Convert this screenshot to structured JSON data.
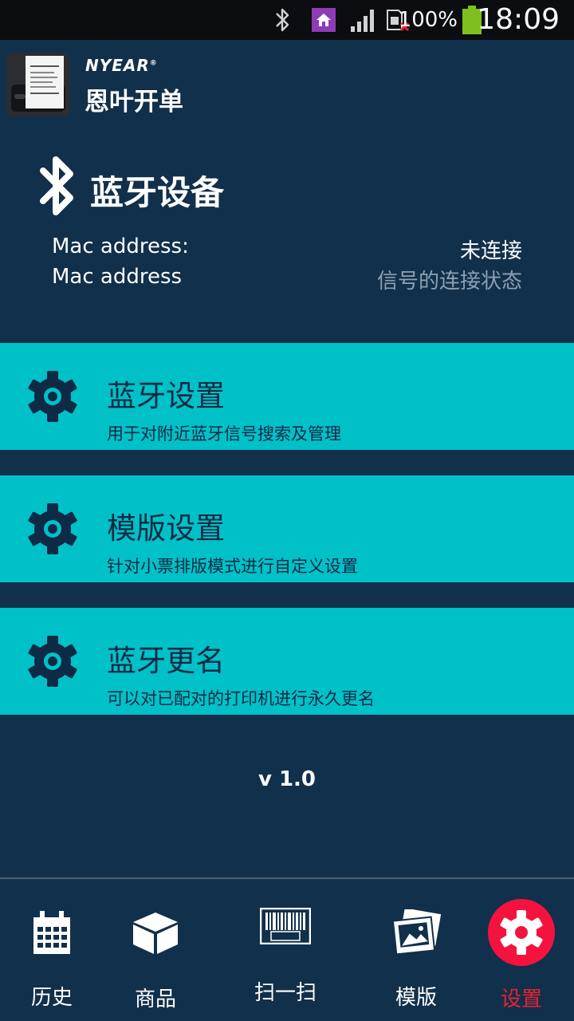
{
  "status_bar": {
    "battery_percent": "100%",
    "time": "18:09"
  },
  "app": {
    "brand": "NYEAR",
    "brand_mark": "®",
    "name": "恩叶开单"
  },
  "bluetooth": {
    "title": "蓝牙设备",
    "mac_label": "Mac address:",
    "mac_value": "Mac address",
    "status": "未连接",
    "status_hint": "信号的连接状态"
  },
  "menu": [
    {
      "title": "蓝牙设置",
      "description": "用于对附近蓝牙信号搜索及管理",
      "icon": "gear-icon"
    },
    {
      "title": "模版设置",
      "description": "针对小票排版模式进行自定义设置",
      "icon": "gear-icon"
    },
    {
      "title": "蓝牙更名",
      "description": "可以对已配对的打印机进行永久更名",
      "icon": "gear-icon"
    }
  ],
  "version": "v 1.0",
  "nav": [
    {
      "label": "历史",
      "icon": "calendar-icon",
      "active": false
    },
    {
      "label": "商品",
      "icon": "box-icon",
      "active": false
    },
    {
      "label": "扫一扫",
      "icon": "barcode-icon",
      "active": false
    },
    {
      "label": "模版",
      "icon": "images-icon",
      "active": false
    },
    {
      "label": "设置",
      "icon": "gear-icon",
      "active": true
    }
  ],
  "colors": {
    "background": "#11304b",
    "card": "#00c1c7",
    "card_text": "#0d2a46",
    "active_nav": "#e8222e",
    "settings_circle": "#f4123f"
  }
}
